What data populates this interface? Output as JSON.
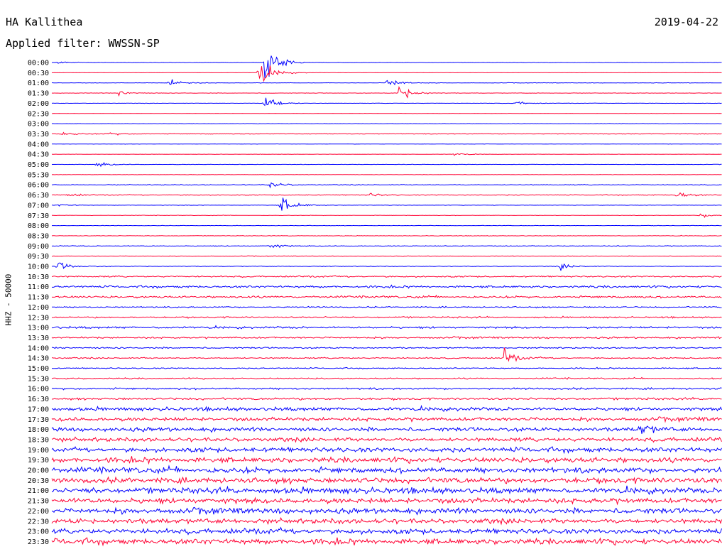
{
  "header": {
    "station": "HA Kallithea",
    "filter": "Applied filter: WWSSN-SP",
    "date": "2019-04-22"
  },
  "colors": {
    "blue": "#0000ff",
    "red": "#ff0033"
  },
  "chart_data": {
    "type": "line",
    "title": "HA Kallithea",
    "subtitle": "Applied filter: WWSSN-SP",
    "date": "2019-04-22",
    "ylabel": "HHZ - 50000",
    "grid": false,
    "series_colors_alternate": [
      "#0000ff",
      "#ff0033"
    ],
    "rows": [
      {
        "label": "00:00",
        "amp": 0.5
      },
      {
        "label": "00:30",
        "amp": 0.4
      },
      {
        "label": "01:00",
        "amp": 0.6
      },
      {
        "label": "01:30",
        "amp": 0.6
      },
      {
        "label": "02:00",
        "amp": 0.5
      },
      {
        "label": "02:30",
        "amp": 0.4
      },
      {
        "label": "03:00",
        "amp": 0.6
      },
      {
        "label": "03:30",
        "amp": 0.9
      },
      {
        "label": "04:00",
        "amp": 0.4
      },
      {
        "label": "04:30",
        "amp": 0.4
      },
      {
        "label": "05:00",
        "amp": 0.5
      },
      {
        "label": "05:30",
        "amp": 0.5
      },
      {
        "label": "06:00",
        "amp": 1.2
      },
      {
        "label": "06:30",
        "amp": 1.2
      },
      {
        "label": "07:00",
        "amp": 0.6
      },
      {
        "label": "07:30",
        "amp": 0.6
      },
      {
        "label": "08:00",
        "amp": 0.6
      },
      {
        "label": "08:30",
        "amp": 0.7
      },
      {
        "label": "09:00",
        "amp": 1.2
      },
      {
        "label": "09:30",
        "amp": 0.9
      },
      {
        "label": "10:00",
        "amp": 1.0
      },
      {
        "label": "10:30",
        "amp": 2.2
      },
      {
        "label": "11:00",
        "amp": 3.2
      },
      {
        "label": "11:30",
        "amp": 3.0
      },
      {
        "label": "12:00",
        "amp": 2.0
      },
      {
        "label": "12:30",
        "amp": 2.2
      },
      {
        "label": "13:00",
        "amp": 3.0
      },
      {
        "label": "13:30",
        "amp": 2.6
      },
      {
        "label": "14:00",
        "amp": 2.2
      },
      {
        "label": "14:30",
        "amp": 2.0
      },
      {
        "label": "15:00",
        "amp": 1.8
      },
      {
        "label": "15:30",
        "amp": 2.0
      },
      {
        "label": "16:00",
        "amp": 2.6
      },
      {
        "label": "16:30",
        "amp": 3.0
      },
      {
        "label": "17:00",
        "amp": 5.0
      },
      {
        "label": "17:30",
        "amp": 5.5
      },
      {
        "label": "18:00",
        "amp": 6.0
      },
      {
        "label": "18:30",
        "amp": 6.0
      },
      {
        "label": "19:00",
        "amp": 7.0
      },
      {
        "label": "19:30",
        "amp": 7.5
      },
      {
        "label": "20:00",
        "amp": 8.0
      },
      {
        "label": "20:30",
        "amp": 8.0
      },
      {
        "label": "21:00",
        "amp": 8.0
      },
      {
        "label": "21:30",
        "amp": 8.0
      },
      {
        "label": "22:00",
        "amp": 8.0
      },
      {
        "label": "22:30",
        "amp": 7.5
      },
      {
        "label": "23:00",
        "amp": 7.5
      },
      {
        "label": "23:30",
        "amp": 8.0
      }
    ],
    "events": [
      {
        "row": 0,
        "minute": 0.5,
        "amp": 3
      },
      {
        "row": 0,
        "minute": 19,
        "amp": 60
      },
      {
        "row": 1,
        "minute": 18.5,
        "amp": 40
      },
      {
        "row": 2,
        "minute": 10.5,
        "amp": 10
      },
      {
        "row": 2,
        "minute": 30,
        "amp": 14
      },
      {
        "row": 3,
        "minute": 6,
        "amp": 7
      },
      {
        "row": 3,
        "minute": 31,
        "amp": 22
      },
      {
        "row": 4,
        "minute": 19,
        "amp": 25
      },
      {
        "row": 4,
        "minute": 41.5,
        "amp": 5
      },
      {
        "row": 7,
        "minute": 1,
        "amp": 4
      },
      {
        "row": 7,
        "minute": 5,
        "amp": 4
      },
      {
        "row": 9,
        "minute": 36,
        "amp": 4
      },
      {
        "row": 10,
        "minute": 4,
        "amp": 7
      },
      {
        "row": 12,
        "minute": 19.5,
        "amp": 8
      },
      {
        "row": 13,
        "minute": 1,
        "amp": 5
      },
      {
        "row": 13,
        "minute": 28.5,
        "amp": 4
      },
      {
        "row": 13,
        "minute": 56,
        "amp": 8
      },
      {
        "row": 14,
        "minute": 20.5,
        "amp": 25
      },
      {
        "row": 14,
        "minute": 0.5,
        "amp": 3
      },
      {
        "row": 15,
        "minute": 58,
        "amp": 5
      },
      {
        "row": 18,
        "minute": 19.5,
        "amp": 6
      },
      {
        "row": 20,
        "minute": 0.5,
        "amp": 12
      },
      {
        "row": 20,
        "minute": 45.5,
        "amp": 8
      },
      {
        "row": 29,
        "minute": 40.5,
        "amp": 20
      },
      {
        "row": 36,
        "minute": 52.5,
        "amp": 16
      }
    ]
  }
}
